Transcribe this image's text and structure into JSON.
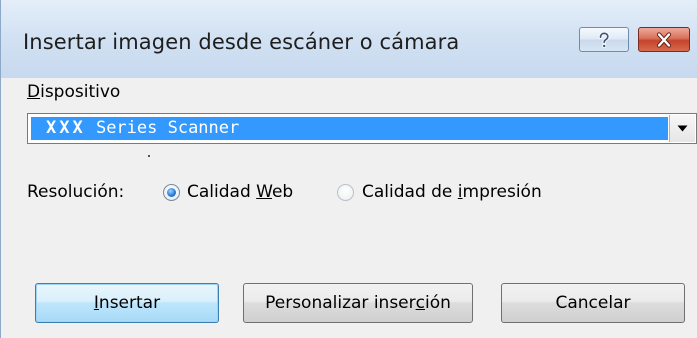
{
  "dialog": {
    "title": "Insertar imagen desde escáner o cámara",
    "help_icon": "help-question-icon",
    "close_icon": "close-x-icon"
  },
  "device": {
    "label_accel": "D",
    "label_rest": "ispositivo",
    "selected_bold": "XXX",
    "selected_rest": " Series Scanner",
    "dropdown_icon": "chevron-down-icon"
  },
  "resolution": {
    "label": "Resolución:",
    "options": [
      {
        "pre": "Calidad ",
        "accel": "W",
        "post": "eb",
        "selected": true
      },
      {
        "pre": "Calidad de ",
        "accel": "i",
        "post": "mpresión",
        "selected": false
      }
    ]
  },
  "buttons": {
    "insert": {
      "accel": "I",
      "rest": "nsertar"
    },
    "custom": {
      "pre": "Personalizar inser",
      "accel": "c",
      "post": "ión"
    },
    "cancel": "Cancelar"
  },
  "colors": {
    "selection": "#3399ff",
    "titlebar": "#d3e2f3",
    "close_button": "#c4442c",
    "default_button": "#bee6fd"
  }
}
